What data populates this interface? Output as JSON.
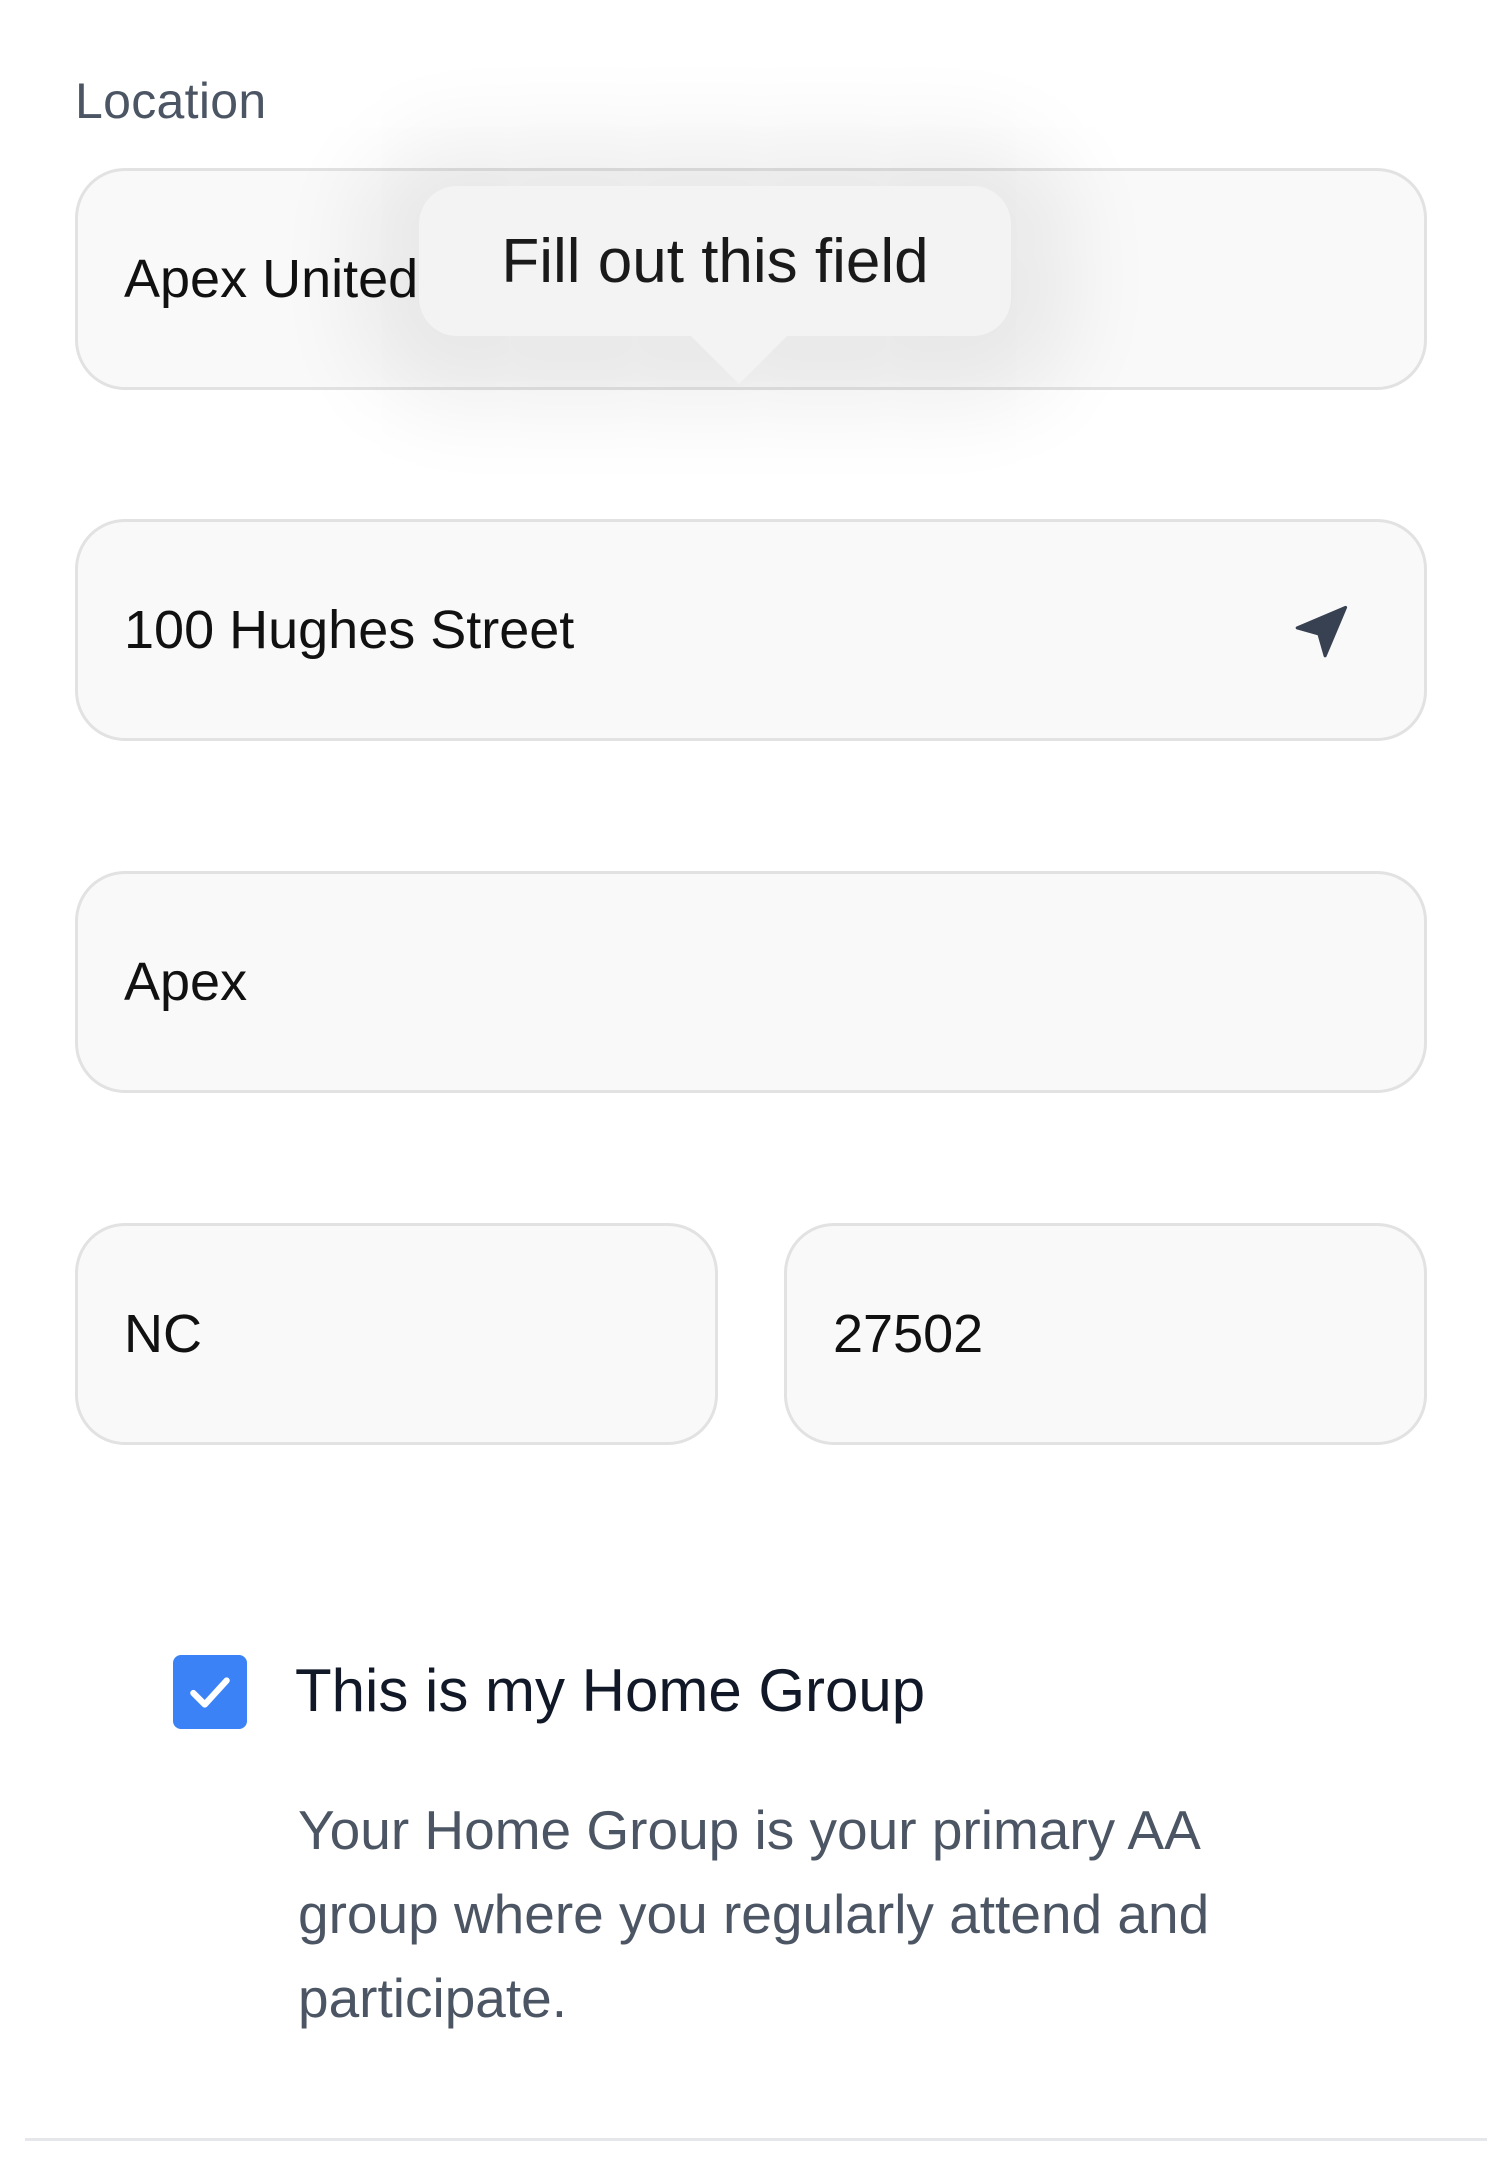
{
  "form": {
    "section_label": "Location",
    "location": {
      "value": "Apex United"
    },
    "street": {
      "value": "100 Hughes Street",
      "icon": "location-arrow-icon"
    },
    "city": {
      "value": "Apex"
    },
    "state": {
      "value": "NC"
    },
    "zip": {
      "value": "27502"
    }
  },
  "tooltip": {
    "text": "Fill out this field"
  },
  "home_group": {
    "checked": true,
    "label": "This is my Home Group",
    "help_text": "Your Home Group is your primary AA group where you regularly attend and participate."
  },
  "colors": {
    "accent": "#3b82f6",
    "field_background": "#f9f9f9",
    "field_border": "#e2e2e2",
    "muted_text": "#4b5563"
  }
}
